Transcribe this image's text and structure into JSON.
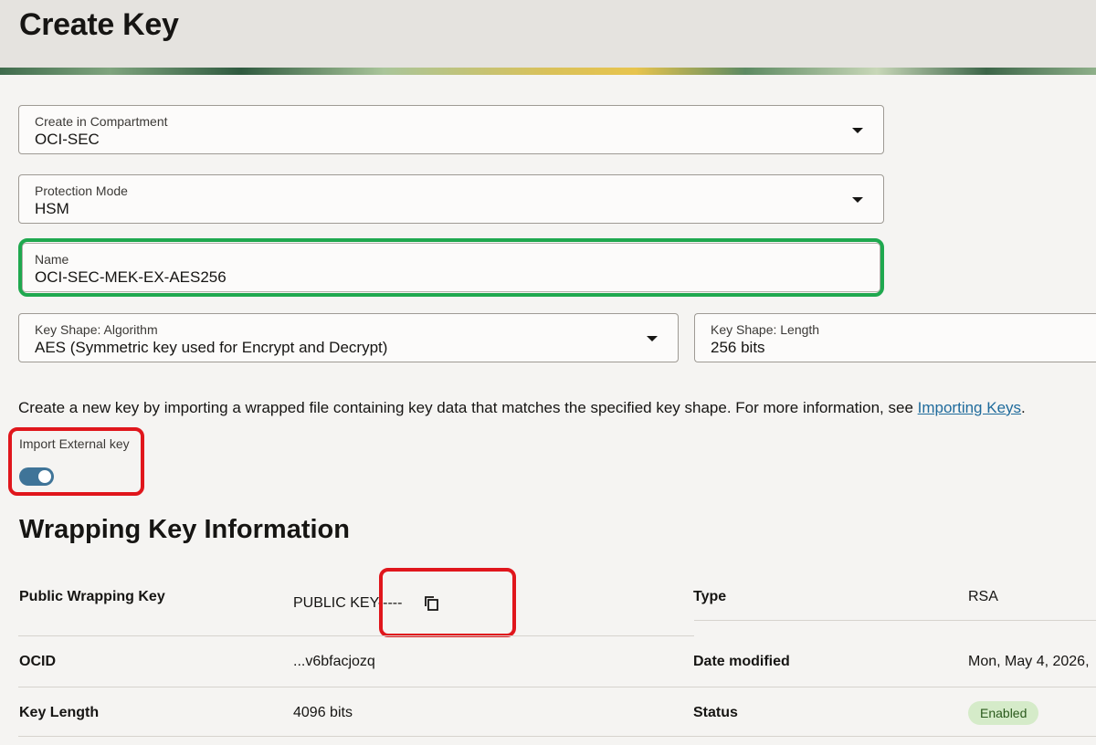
{
  "page": {
    "title": "Create Key"
  },
  "form": {
    "compartment": {
      "label": "Create in Compartment",
      "value": "OCI-SEC"
    },
    "protection_mode": {
      "label": "Protection Mode",
      "value": "HSM"
    },
    "name": {
      "label": "Name",
      "value": "OCI-SEC-MEK-EX-AES256"
    },
    "algorithm": {
      "label": "Key Shape: Algorithm",
      "value": "AES (Symmetric key used for Encrypt and Decrypt)"
    },
    "length": {
      "label": "Key Shape: Length",
      "value": "256 bits"
    }
  },
  "import": {
    "description": "Create a new key by importing a wrapped file containing key data that matches the specified key shape. For more information, see ",
    "link_text": "Importing Keys",
    "description_end": ".",
    "toggle_label": "Import External key",
    "toggle_on": true
  },
  "wrapping": {
    "title": "Wrapping Key Information",
    "public_key_label": "Public Wrapping Key",
    "public_key_value": "PUBLIC KEY-----",
    "type_label": "Type",
    "type_value": "RSA",
    "ocid_label": "OCID",
    "ocid_value": "...v6bfacjozq",
    "date_label": "Date modified",
    "date_value": "Mon, May 4, 2026,",
    "key_length_label": "Key Length",
    "key_length_value": "4096 bits",
    "status_label": "Status",
    "status_value": "Enabled"
  },
  "colors": {
    "name_highlight": "#1fa84f",
    "callout_red": "#e0161c",
    "link": "#1f6b9c",
    "toggle_on": "#3f7498",
    "status_badge_bg": "#d5ebc9"
  },
  "icons": {
    "copy": "copy-icon",
    "dropdown": "chevron-down-icon"
  }
}
